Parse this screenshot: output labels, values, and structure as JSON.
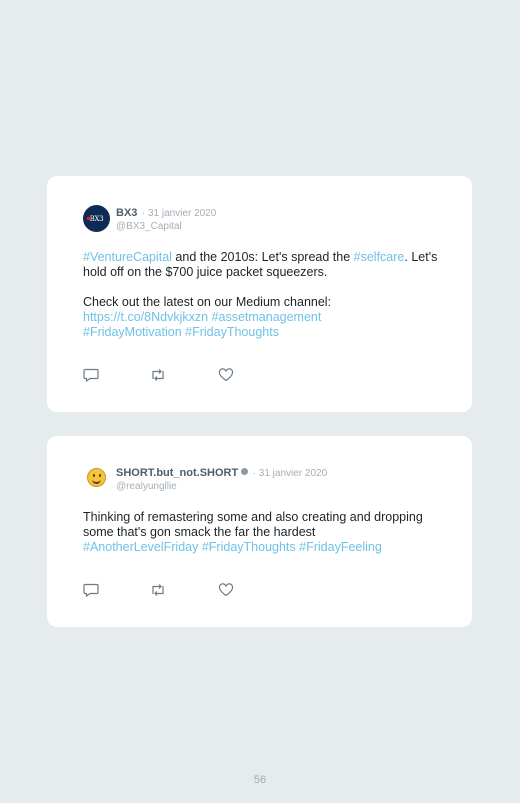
{
  "tweets": [
    {
      "username": "BX3",
      "date": "· 31 janvier 2020",
      "handle": "@BX3_Capital",
      "avatar_icon": "bx3-logo-avatar",
      "avatar_text": "BX3",
      "segments": [
        {
          "text": "#VentureCapital",
          "type": "hashtag"
        },
        {
          "text": " and the 2010s: Let's spread the ",
          "type": "text"
        },
        {
          "text": "#selfcare",
          "type": "hashtag"
        },
        {
          "text": ". Let's hold off on the $700 juice packet squeezers.\n\nCheck out the latest on our Medium channel:\n",
          "type": "text"
        },
        {
          "text": "https://t.co/8Ndvkjkxzn",
          "type": "link"
        },
        {
          "text": " ",
          "type": "text"
        },
        {
          "text": "#assetmanagement",
          "type": "hashtag"
        },
        {
          "text": "\n",
          "type": "text"
        },
        {
          "text": "#FridayMotivation",
          "type": "hashtag"
        },
        {
          "text": " ",
          "type": "text"
        },
        {
          "text": "#FridayThoughts",
          "type": "hashtag"
        }
      ]
    },
    {
      "username": "SHORT.but_not.SHORT",
      "date": "· 31 janvier 2020",
      "handle": "@realyungllie",
      "avatar_icon": "smiley-face-avatar",
      "verified_icon": "verified-badge-icon",
      "segments": [
        {
          "text": "Thinking of remastering some and also creating and dropping some that's gon smack the far the hardest\n",
          "type": "text"
        },
        {
          "text": "#AnotherLevelFriday",
          "type": "hashtag"
        },
        {
          "text": " ",
          "type": "text"
        },
        {
          "text": "#FridayThoughts",
          "type": "hashtag"
        },
        {
          "text": " ",
          "type": "text"
        },
        {
          "text": "#FridayFeeling",
          "type": "hashtag"
        }
      ]
    }
  ],
  "actions": [
    "reply-icon",
    "retweet-icon",
    "like-icon"
  ],
  "colors": {
    "hashtag": "#6fc1e8",
    "background": "#e6ebed",
    "icon": "#6b7a86"
  },
  "page_number": "56"
}
